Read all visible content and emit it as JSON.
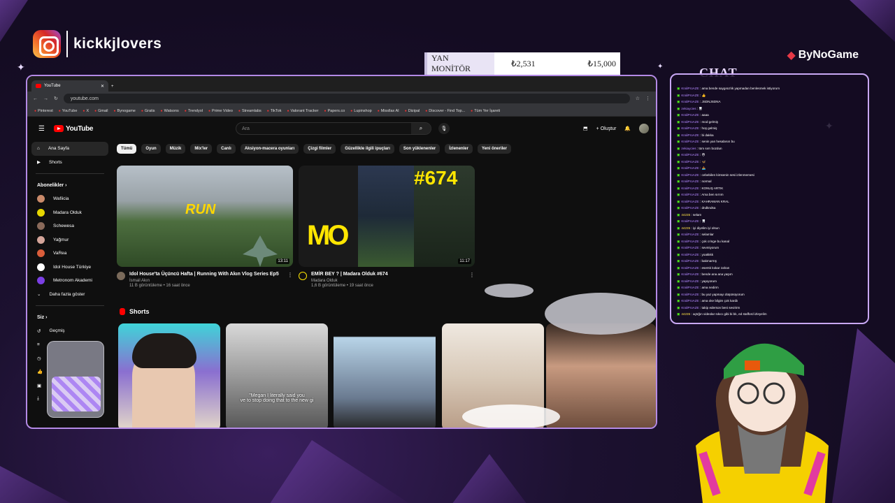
{
  "overlay": {
    "handle": "kickkjlovers",
    "sponsor": "ByNoGame",
    "monitor": {
      "label": "YAN MONİTÖR",
      "current": "₺2,531",
      "goal": "₺15,000"
    },
    "chat_title": "CHAT"
  },
  "browser": {
    "tab_title": "YouTube",
    "url": "youtube.com",
    "bookmarks": [
      "Pinterest",
      "YouTube",
      "X",
      "Gmail",
      "Bynogame",
      "Gratis",
      "Watsons",
      "Trendyol",
      "Prime Video",
      "Streamlabs",
      "TikTok",
      "Valorant Tracker",
      "Papers.co",
      "Lupinshop",
      "Missllax AI",
      "Dizipal",
      "Discover - Find Top...",
      "Tüm Yer İşareti"
    ]
  },
  "youtube": {
    "logo": "YouTube",
    "search_placeholder": "Ara",
    "create_label": "Oluştur",
    "sidebar": {
      "home": "Ana Sayfa",
      "shorts": "Shorts",
      "subs_header": "Abonelikler",
      "subscriptions": [
        {
          "name": "Wafiicia",
          "color": "#c98a6a"
        },
        {
          "name": "Madara Olduk",
          "color": "#e6d700"
        },
        {
          "name": "Schewesa",
          "color": "#8a6a5a"
        },
        {
          "name": "Yağmur",
          "color": "#d4a59a"
        },
        {
          "name": "VaRea",
          "color": "#d95d3a"
        },
        {
          "name": "Idol House Türkiye",
          "color": "#ffffff"
        },
        {
          "name": "Metronom Akademi",
          "color": "#7b3fe4"
        }
      ],
      "more": "Daha fazla göster",
      "you_header": "Siz",
      "history": "Geçmiş"
    },
    "chips": [
      "Tümü",
      "Oyun",
      "Müzik",
      "Mix'ler",
      "Canlı",
      "Aksiyon-macera oyunları",
      "Çizgi filmler",
      "Güzellikle ilgili ipuçları",
      "Son yüklenenler",
      "İzlenenler",
      "Yeni öneriler"
    ],
    "videos": [
      {
        "title": "Idol House'ta Üçüncü Hafta | Running With Akın Vlog Series Ep5",
        "channel": "İsmail Akın",
        "stats": "11 B görüntüleme • 16 saat önce",
        "duration": "13:11",
        "overlay": "RUN"
      },
      {
        "title": "EMİR BEY ? | Madara Olduk #674",
        "channel": "Madara Olduk",
        "stats": "1,6 B görüntüleme • 19 saat önce",
        "duration": "11:17",
        "overlay": "#674"
      }
    ],
    "shorts_header": "Shorts",
    "short_captions": [
      "",
      "\"Megan I literally said you\nve to stop doing that to the new gi",
      "",
      "",
      ""
    ]
  },
  "chat": [
    {
      "user": "KraliProAZE",
      "text": "ama bende saygısızlık yapmadan benlesmek istiyorum"
    },
    {
      "user": "KraliProAZE",
      "text": "👍"
    },
    {
      "user": "KraliProAZE",
      "text": "JSDNJSDNA"
    },
    {
      "user": "zekiaycies",
      "text": "🦷",
      "alt": true
    },
    {
      "user": "KraliProAZE",
      "text": "aaaa"
    },
    {
      "user": "KraliProAZE",
      "text": "mod gelmiş"
    },
    {
      "user": "KraliProAZE",
      "text": "hoş gelmiş"
    },
    {
      "user": "KraliProAZE",
      "text": "bi dakka"
    },
    {
      "user": "KraliProAZE",
      "text": "senin yan hesabısın bu"
    },
    {
      "user": "zekiaycies",
      "text": "tüm sırrı bozdun",
      "alt": true
    },
    {
      "user": "KraliProAZE",
      "text": "😳"
    },
    {
      "user": "KraliProAZE",
      "text": "🦋"
    },
    {
      "user": "KraliProAZE",
      "text": "🚣"
    },
    {
      "user": "KraliProAZE",
      "text": "cebebilen kimsenin sesi izlenmemesi"
    },
    {
      "user": "KraliProAZE",
      "text": "normal"
    },
    {
      "user": "KraliProAZE",
      "text": "KONUŞ ARTIK"
    },
    {
      "user": "KraliProAZE",
      "text": "Ama ben sırrım"
    },
    {
      "user": "KraliProAZE",
      "text": "KAHRAMAN KRAL"
    },
    {
      "user": "KraliProAZE",
      "text": "dndkndsa"
    },
    {
      "user": "44235",
      "text": "selam",
      "alt2": true
    },
    {
      "user": "KraliProAZE",
      "text": "🦷"
    },
    {
      "user": "44235",
      "text": "iyi diyelim iyi olsun",
      "alt2": true
    },
    {
      "user": "KraliProAZE",
      "text": "selamlar"
    },
    {
      "user": "KraliProAZE",
      "text": "çok cringe bu kanal"
    },
    {
      "user": "KraliProAZE",
      "text": "sevmiyorum"
    },
    {
      "user": "KraliProAZE",
      "text": "yoakkkk"
    },
    {
      "user": "KraliProAZE",
      "text": "bakmarmş"
    },
    {
      "user": "KraliProAZE",
      "text": "esersk kokar zahan"
    },
    {
      "user": "KraliProAZE",
      "text": "bende ana ana yaşım"
    },
    {
      "user": "KraliProAZE",
      "text": "yapıyorum"
    },
    {
      "user": "KraliProAZE",
      "text": "ama nedirm"
    },
    {
      "user": "KraliProAZE",
      "text": "bu yaz yapmayı düşünüyorum"
    },
    {
      "user": "KraliProAZE",
      "text": "ama oke bilgim çok kardiı"
    },
    {
      "user": "KraliProAZE",
      "text": "takip ederson beni sevirirm"
    },
    {
      "user": "44235",
      "text": "açtığın videolar sıkıcı gibi bi bk, ed stafford izleyelim",
      "alt2": true
    }
  ],
  "colors": {
    "frame_border": "#b48ae6",
    "chat_border": "#c9a8f5",
    "kick_green": "#53fc18",
    "yt_red": "#ff0000"
  }
}
